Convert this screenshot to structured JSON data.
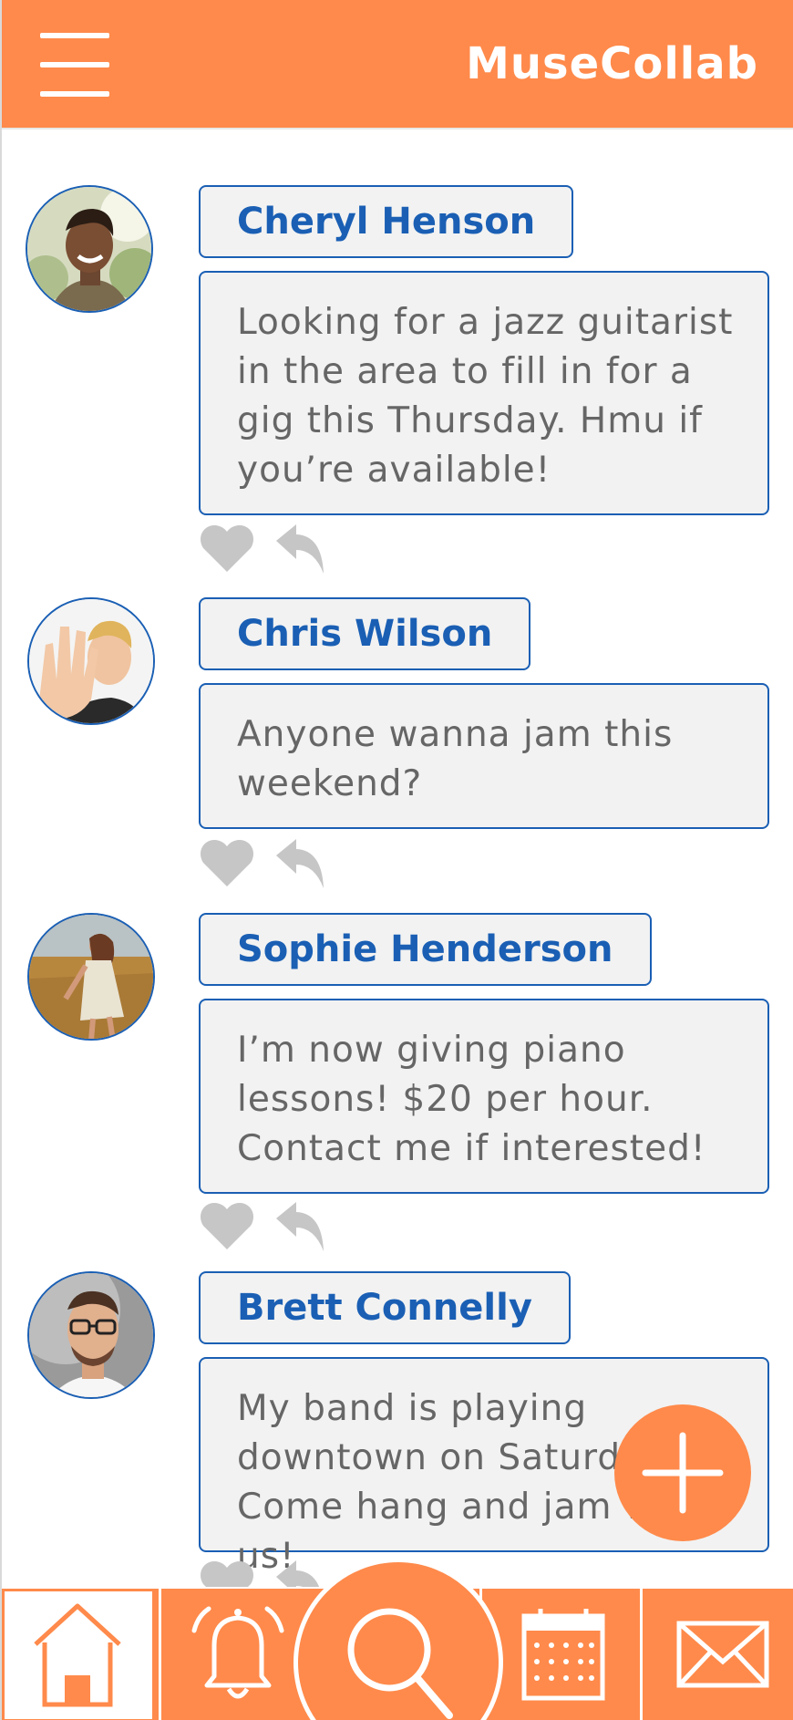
{
  "app": {
    "title": "MuseCollab",
    "accent_color": "#ff8a4b",
    "name_color": "#1a5fb4"
  },
  "header": {
    "menu_icon": "hamburger-menu-icon"
  },
  "posts": [
    {
      "author": "Cheryl Henson",
      "text": "Looking for a jazz guitarist in the area to fill in for a gig this Thursday. Hmu if you’re available!",
      "avatar_icon": "avatar-photo-woman-smiling"
    },
    {
      "author": "Chris Wilson",
      "text": "Anyone wanna jam this weekend?",
      "avatar_icon": "avatar-photo-man-hand-raised"
    },
    {
      "author": "Sophie Henderson",
      "text": "I’m now giving piano lessons! $20 per hour. Contact me if interested!",
      "avatar_icon": "avatar-photo-woman-field"
    },
    {
      "author": "Brett Connelly",
      "text": "My band is playing downtown on Saturday. Come hang and jam with us!",
      "avatar_icon": "avatar-photo-man-glasses"
    }
  ],
  "post_actions": {
    "like_icon": "heart-icon",
    "reply_icon": "reply-arrow-icon"
  },
  "fab": {
    "icon": "plus-icon"
  },
  "bottom_nav": {
    "items": [
      "home-icon",
      "bell-icon",
      "search-icon",
      "calendar-icon",
      "mail-icon"
    ],
    "active": "home-icon"
  }
}
